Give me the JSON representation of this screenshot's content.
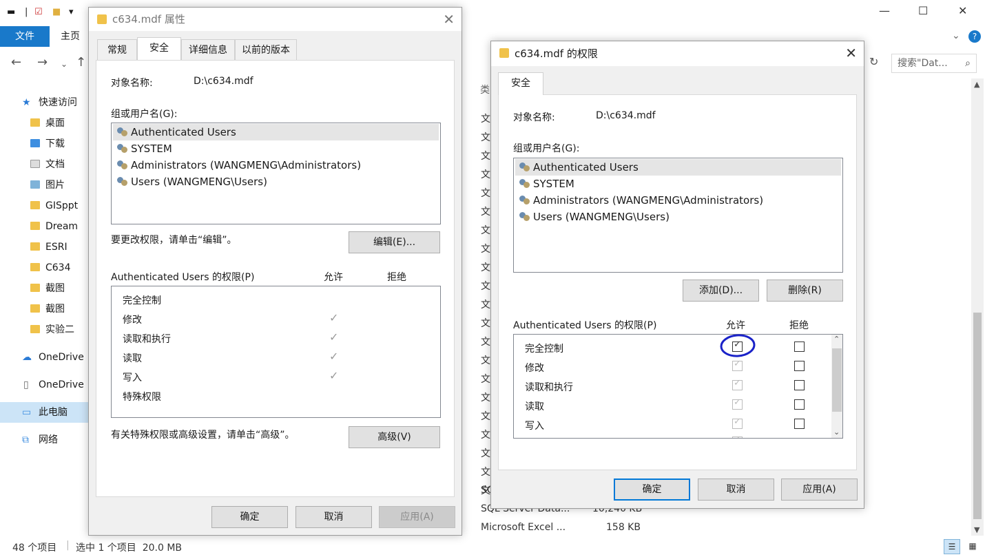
{
  "explorer": {
    "ribbon_tabs": [
      "文件",
      "主页"
    ],
    "search_placeholder": "搜索\"Dat...",
    "sidebar": [
      {
        "label": "快速访问",
        "icon": "star-icon"
      },
      {
        "label": "桌面",
        "icon": "folder-icon"
      },
      {
        "label": "下载",
        "icon": "download-icon"
      },
      {
        "label": "文档",
        "icon": "document-icon"
      },
      {
        "label": "图片",
        "icon": "picture-icon"
      },
      {
        "label": "GISppt",
        "icon": "folder-icon"
      },
      {
        "label": "Dream",
        "icon": "folder-icon"
      },
      {
        "label": "ESRI",
        "icon": "folder-icon"
      },
      {
        "label": "C634",
        "icon": "folder-icon"
      },
      {
        "label": "截图",
        "icon": "folder-icon"
      },
      {
        "label": "截图",
        "icon": "folder-icon"
      },
      {
        "label": "实验二",
        "icon": "folder-icon"
      },
      {
        "label": "OneDrive",
        "icon": "cloud-icon"
      },
      {
        "label": "OneDrive",
        "icon": "file-icon"
      },
      {
        "label": "此电脑",
        "icon": "computer-icon"
      },
      {
        "label": "网络",
        "icon": "network-icon"
      }
    ],
    "column_header": "类",
    "type_cells": [
      "文",
      "文",
      "文",
      "文",
      "文",
      "文",
      "文",
      "文",
      "文",
      "文",
      "文",
      "文",
      "文",
      "文",
      "文",
      "文",
      "文",
      "文",
      "文",
      "文",
      "文"
    ],
    "rows": [
      {
        "type": "SQ",
        "size": ""
      },
      {
        "type": "SQL Server Data...",
        "size": "10,240 KB"
      },
      {
        "type": "Microsoft Excel ...",
        "size": "158 KB"
      }
    ],
    "status": {
      "count": "48 个项目",
      "selection": "选中 1 个项目  20.0 MB"
    }
  },
  "props_dialog": {
    "title": "c634.mdf 属性",
    "tabs": [
      "常规",
      "安全",
      "详细信息",
      "以前的版本"
    ],
    "object_label": "对象名称:",
    "object_value": "D:\\c634.mdf",
    "group_label": "组或用户名(G):",
    "users": [
      "Authenticated Users",
      "SYSTEM",
      "Administrators (WANGMENG\\Administrators)",
      "Users (WANGMENG\\Users)"
    ],
    "edit_hint": "要更改权限，请单击“编辑”。",
    "edit_button": "编辑(E)...",
    "perm_label": "Authenticated Users 的权限(P)",
    "allow": "允许",
    "deny": "拒绝",
    "permissions": [
      {
        "name": "完全控制",
        "allow": false
      },
      {
        "name": "修改",
        "allow": true
      },
      {
        "name": "读取和执行",
        "allow": true
      },
      {
        "name": "读取",
        "allow": true
      },
      {
        "name": "写入",
        "allow": true
      },
      {
        "name": "特殊权限",
        "allow": false
      }
    ],
    "advanced_hint": "有关特殊权限或高级设置，请单击“高级”。",
    "advanced_button": "高级(V)",
    "ok": "确定",
    "cancel": "取消",
    "apply": "应用(A)"
  },
  "perm_dialog": {
    "title": "c634.mdf 的权限",
    "tab": "安全",
    "object_label": "对象名称:",
    "object_value": "D:\\c634.mdf",
    "group_label": "组或用户名(G):",
    "users": [
      "Authenticated Users",
      "SYSTEM",
      "Administrators (WANGMENG\\Administrators)",
      "Users (WANGMENG\\Users)"
    ],
    "add_button": "添加(D)...",
    "remove_button": "删除(R)",
    "perm_label": "Authenticated Users 的权限(P)",
    "allow": "允许",
    "deny": "拒绝",
    "permissions": [
      {
        "name": "完全控制",
        "allow": "checked",
        "deny": false
      },
      {
        "name": "修改",
        "allow": "disabled-checked",
        "deny": false
      },
      {
        "name": "读取和执行",
        "allow": "disabled-checked",
        "deny": false
      },
      {
        "name": "读取",
        "allow": "disabled-checked",
        "deny": false
      },
      {
        "name": "写入",
        "allow": "disabled-checked",
        "deny": false
      }
    ],
    "ok": "确定",
    "cancel": "取消",
    "apply": "应用(A)",
    "annotation_color": "#1a22c8"
  }
}
